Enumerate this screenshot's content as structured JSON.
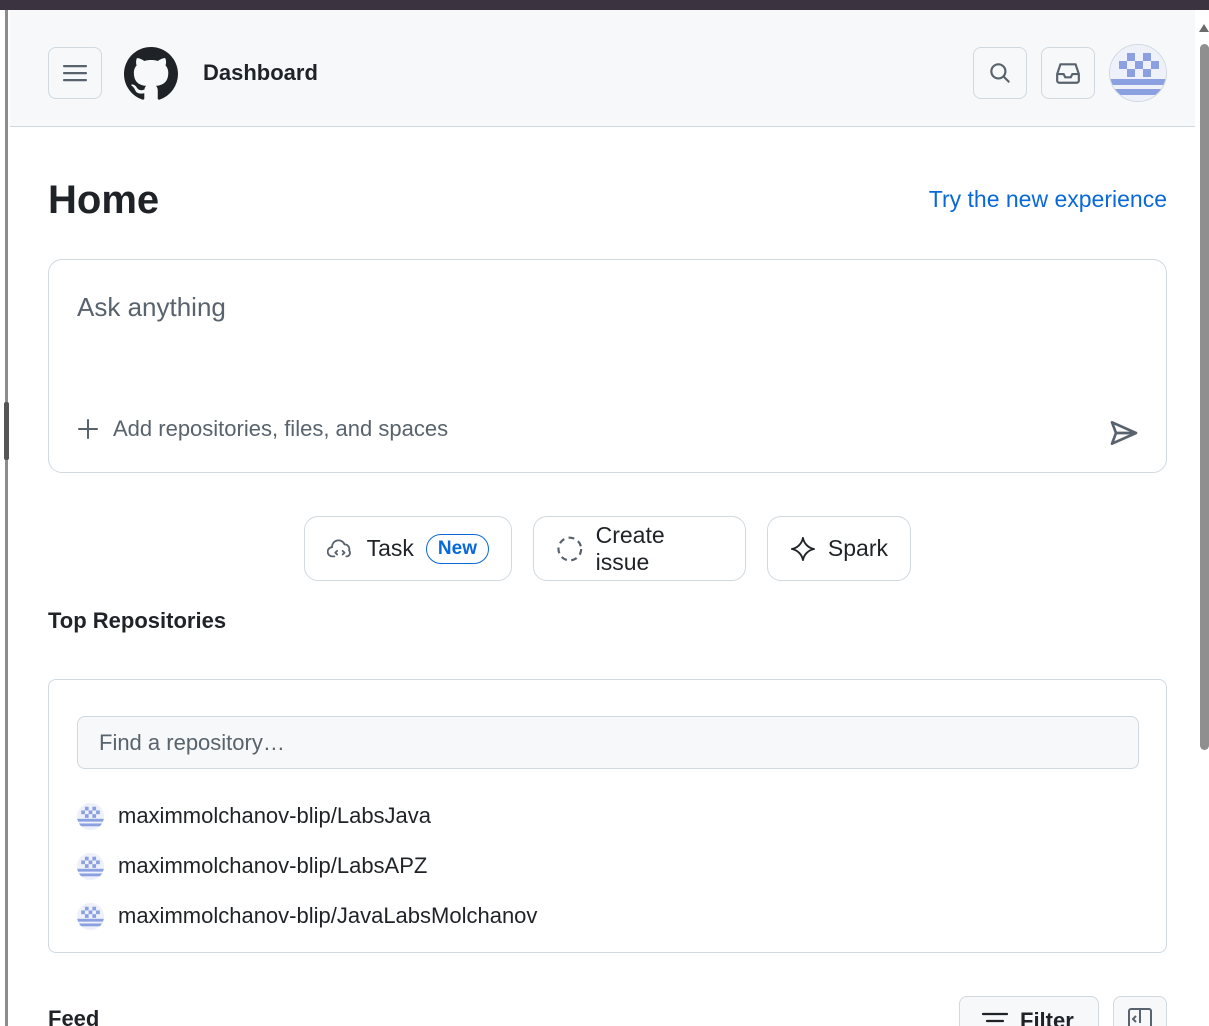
{
  "header": {
    "title": "Dashboard",
    "menu_icon": "hamburger-icon",
    "logo_icon": "github-mark-icon",
    "search_icon": "search-icon",
    "inbox_icon": "inbox-icon"
  },
  "main": {
    "title": "Home",
    "try_link": "Try the new experience",
    "ask": {
      "placeholder": "Ask anything",
      "add_context_label": "Add repositories, files, and spaces"
    },
    "actions": [
      {
        "label": "Task",
        "badge": "New",
        "icon": "cloud-agent-icon"
      },
      {
        "label": "Create issue",
        "icon": "issue-dashed-circle-icon"
      },
      {
        "label": "Spark",
        "icon": "sparkle-icon"
      }
    ],
    "top_repositories": {
      "title": "Top Repositories",
      "search_placeholder": "Find a repository…",
      "items": [
        {
          "name": "maximmolchanov-blip/LabsJava"
        },
        {
          "name": "maximmolchanov-blip/LabsAPZ"
        },
        {
          "name": "maximmolchanov-blip/JavaLabsMolchanov"
        }
      ]
    },
    "feed": {
      "title": "Feed",
      "filter_label": "Filter"
    }
  },
  "colors": {
    "accent": "#0969da",
    "border": "#d1d9e0",
    "header_bg": "#f6f8fa",
    "text": "#1f2328",
    "muted_text": "#59636e",
    "avatar_blue": "#8aa0e0"
  }
}
